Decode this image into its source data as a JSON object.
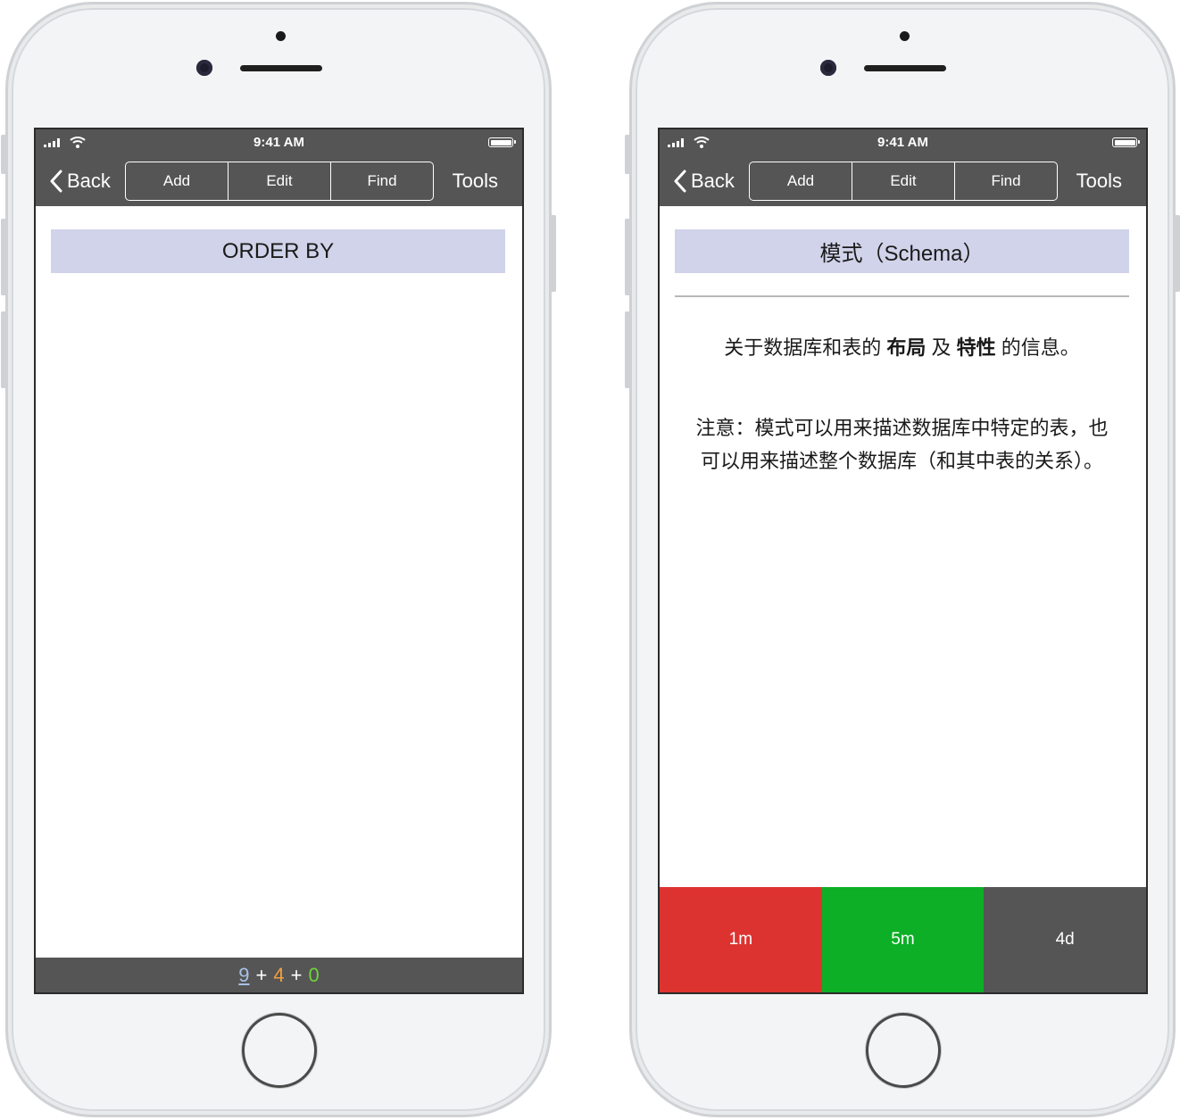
{
  "phones": [
    {
      "status": {
        "time": "9:41 AM"
      },
      "nav": {
        "back_label": "Back",
        "segments": [
          "Add",
          "Edit",
          "Find"
        ],
        "tools_label": "Tools"
      },
      "header_title": "ORDER BY",
      "footer": {
        "count_1": "9",
        "plus_1": "+",
        "count_2": "4",
        "plus_2": "+",
        "count_3": "0",
        "colors": [
          "#a6c2e6",
          "#f0a040",
          "#6fd33a"
        ]
      }
    },
    {
      "status": {
        "time": "9:41 AM"
      },
      "nav": {
        "back_label": "Back",
        "segments": [
          "Add",
          "Edit",
          "Find"
        ],
        "tools_label": "Tools"
      },
      "header_title": "模式（Schema）",
      "description": {
        "before": "关于数据库和表的 ",
        "bold_1": "布局",
        "middle": " 及 ",
        "bold_2": "特性",
        "after": " 的信息。"
      },
      "note": "注意：模式可以用来描述数据库中特定的表，也可以用来描述整个数据库（和其中表的关系）。",
      "actions": [
        {
          "label": "1m",
          "color": "#dd3330"
        },
        {
          "label": "5m",
          "color": "#0caf26"
        },
        {
          "label": "4d",
          "color": "#555555"
        }
      ]
    }
  ],
  "icons": {
    "back": "chevron-left-icon",
    "signal": "signal-icon",
    "wifi": "wifi-icon",
    "battery": "battery-icon"
  },
  "colors": {
    "bar": "#555555",
    "header_band": "#d0d3e9"
  }
}
